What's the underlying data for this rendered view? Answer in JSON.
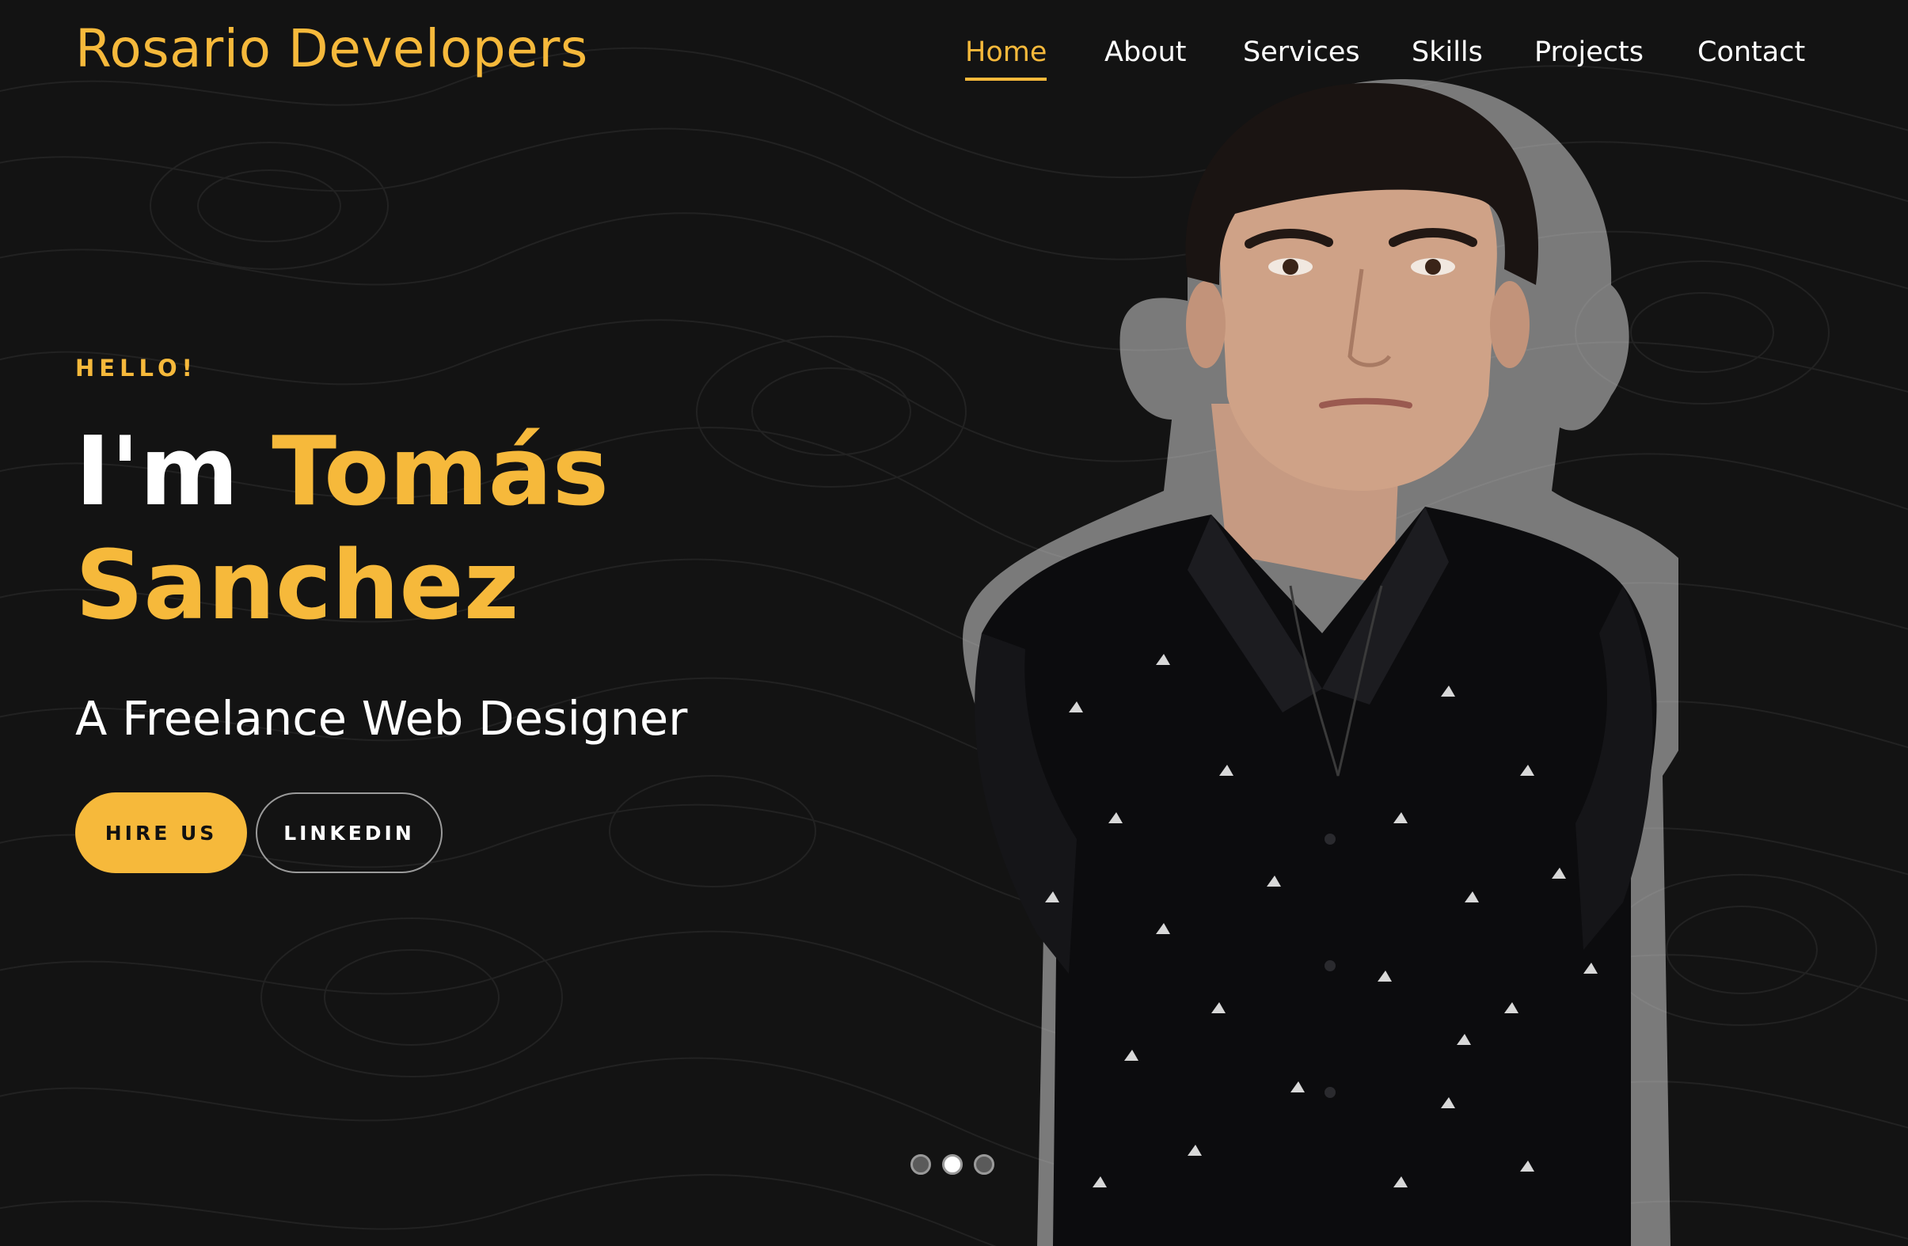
{
  "header": {
    "brand": "Rosario Developers"
  },
  "nav": {
    "items": [
      {
        "label": "Home",
        "active": true
      },
      {
        "label": "About",
        "active": false
      },
      {
        "label": "Services",
        "active": false
      },
      {
        "label": "Skills",
        "active": false
      },
      {
        "label": "Projects",
        "active": false
      },
      {
        "label": "Contact",
        "active": false
      }
    ]
  },
  "hero": {
    "greeting": "HELLO!",
    "name_prefix": "I'm",
    "first_name": "Tomás",
    "last_name": "Sanchez",
    "subtitle": "A Freelance Web Designer",
    "hire_button": "HIRE US",
    "linkedin_button": "LINKEDIN"
  },
  "carousel": {
    "dot_count": 3,
    "active_index": 1
  },
  "colors": {
    "accent": "#f6b93b",
    "background": "#131313",
    "text": "#ffffff"
  },
  "icons": {
    "portrait": "person-portrait-image"
  }
}
